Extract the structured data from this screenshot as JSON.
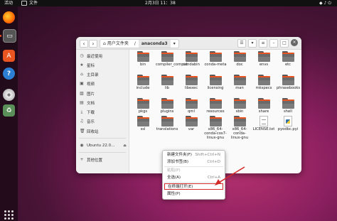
{
  "topbar": {
    "activities": "活动",
    "app_name": "文件",
    "clock": "2月3日  11：38"
  },
  "window": {
    "path": [
      "用户文件夹",
      "anaconda3"
    ]
  },
  "sidebar": {
    "items": [
      {
        "label": "最近使用",
        "icon": "clock-icon"
      },
      {
        "label": "星标",
        "icon": "star-icon"
      },
      {
        "label": "主目录",
        "icon": "home-icon"
      },
      {
        "label": "视频",
        "icon": "video-icon"
      },
      {
        "label": "图片",
        "icon": "picture-icon"
      },
      {
        "label": "文档",
        "icon": "document-icon"
      },
      {
        "label": "下载",
        "icon": "download-icon"
      },
      {
        "label": "音乐",
        "icon": "music-icon"
      },
      {
        "label": "回收站",
        "icon": "trash-icon"
      },
      {
        "label": "Ubuntu 22.0…",
        "icon": "disc-icon"
      },
      {
        "label": "其他位置",
        "icon": "plus-icon"
      }
    ]
  },
  "files": [
    "bin",
    "compiler_compat",
    "condabin",
    "conda-meta",
    "doc",
    "envs",
    "etc",
    "include",
    "lib",
    "libexec",
    "licensing",
    "man",
    "mkspecs",
    "phrasebooks",
    "pkgs",
    "plugins",
    "qml",
    "resources",
    "sbin",
    "share",
    "shell",
    "ssl",
    "translations",
    "var",
    "x86_64-conda-cos7-linux-gnu",
    "x86_64-conda-linux-gnu",
    "LICENSE.txt",
    "pyodbc.pyi"
  ],
  "context_menu": {
    "items": [
      {
        "label": "新建文件夹(F)",
        "shortcut": "Shift+Ctrl+N"
      },
      {
        "label": "添加书签(B)",
        "shortcut": "Ctrl+D"
      },
      {
        "label": "粘贴(P)",
        "shortcut": "",
        "disabled": true
      },
      {
        "label": "全选(A)",
        "shortcut": "Ctrl+A"
      },
      {
        "label": "在终端打开(E)",
        "shortcut": ""
      },
      {
        "label": "属性(P)",
        "shortcut": ""
      }
    ]
  },
  "colors": {
    "accent": "#e95420",
    "highlight_box": "#d42a2a"
  }
}
